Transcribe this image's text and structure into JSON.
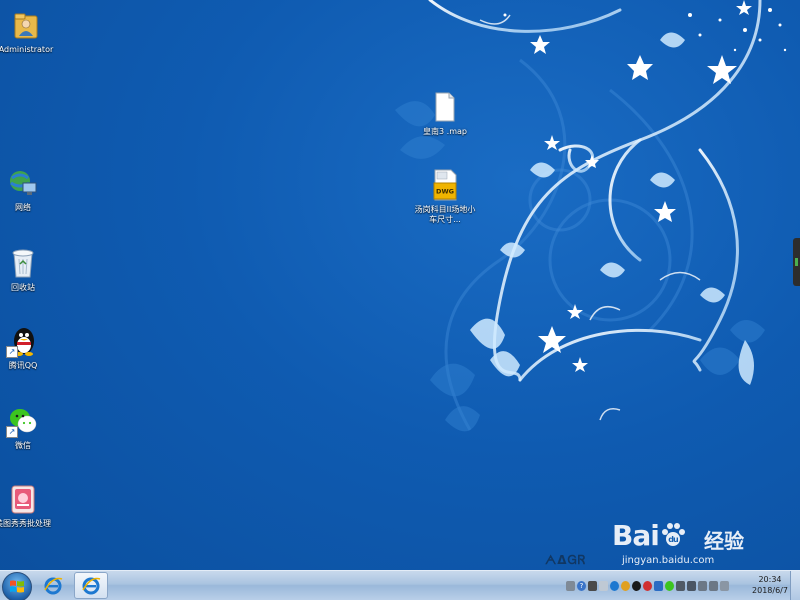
{
  "desktop": {
    "left_icons": [
      {
        "label": "Administrator",
        "icon": "user-folder-icon"
      },
      {
        "label": "网络",
        "icon": "network-globe-icon"
      },
      {
        "label": "回收站",
        "icon": "recycle-bin-icon"
      },
      {
        "label": "腾讯QQ",
        "icon": "qq-penguin-icon"
      },
      {
        "label": "微信",
        "icon": "wechat-icon"
      },
      {
        "label": "美图秀秀批处理",
        "icon": "meitu-icon"
      }
    ],
    "file_icons": [
      {
        "label": "皇南3 .map",
        "icon": "blank-file-icon"
      },
      {
        "label": "汤岗科目II场地小车尺寸...",
        "icon": "dwg-file-icon"
      }
    ],
    "dwg_badge": "DWG"
  },
  "taskbar": {
    "clock_time": "20:34",
    "clock_date": "2018/6/7",
    "pinned": [
      {
        "name": "internet-explorer",
        "active": false
      },
      {
        "name": "internet-explorer-window",
        "active": true
      }
    ]
  },
  "watermark": {
    "brand": "Bai",
    "paw": "du",
    "cn": "经验",
    "url": "jingyan.baidu.com"
  }
}
